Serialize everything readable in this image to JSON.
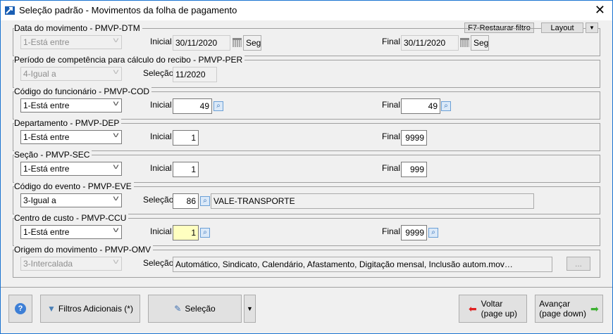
{
  "window": {
    "title": "Seleção padrão - Movimentos da folha de pagamento",
    "close": "✕"
  },
  "toolbar": {
    "restore": "F7-Restaurar filtro",
    "layout": "Layout",
    "dropdown": "▼"
  },
  "groups": {
    "dtm": {
      "label": "Data do movimento - PMVP-DTM",
      "op": "1-Está entre",
      "l1": "Inicial",
      "v1": "30/11/2020",
      "seg1": "Seg",
      "l2": "Final",
      "v2": "30/11/2020",
      "seg2": "Seg"
    },
    "per": {
      "label": "Período de competência para cálculo do recibo - PMVP-PER",
      "op": "4-Igual a",
      "l1": "Seleção",
      "v1": "11/2020"
    },
    "cod": {
      "label": "Código do funcionário - PMVP-COD",
      "op": "1-Está entre",
      "l1": "Inicial",
      "v1": "49",
      "l2": "Final",
      "v2": "49"
    },
    "dep": {
      "label": "Departamento - PMVP-DEP",
      "op": "1-Está entre",
      "l1": "Inicial",
      "v1": "1",
      "l2": "Final",
      "v2": "9999"
    },
    "sec": {
      "label": "Seção - PMVP-SEC",
      "op": "1-Está entre",
      "l1": "Inicial",
      "v1": "1",
      "l2": "Final",
      "v2": "999"
    },
    "eve": {
      "label": "Código do evento - PMVP-EVE",
      "op": "3-Igual a",
      "l1": "Seleção",
      "v1": "86",
      "desc": "VALE-TRANSPORTE"
    },
    "ccu": {
      "label": "Centro de custo - PMVP-CCU",
      "op": "1-Está entre",
      "l1": "Inicial",
      "v1": "1",
      "l2": "Final",
      "v2": "9999"
    },
    "omv": {
      "label": "Origem do movimento - PMVP-OMV",
      "op": "3-Intercalada",
      "l1": "Seleção",
      "v1": "Automático, Sindicato, Calendário, Afastamento, Digitação mensal, Inclusão autom.mov…",
      "more": "..."
    }
  },
  "footer": {
    "help": "?",
    "filters": "Filtros Adicionais (*)",
    "selection": "Seleção",
    "dropdown": "▼",
    "back": "Voltar",
    "back_sub": "(page up)",
    "next": "Avançar",
    "next_sub": "(page down)"
  }
}
